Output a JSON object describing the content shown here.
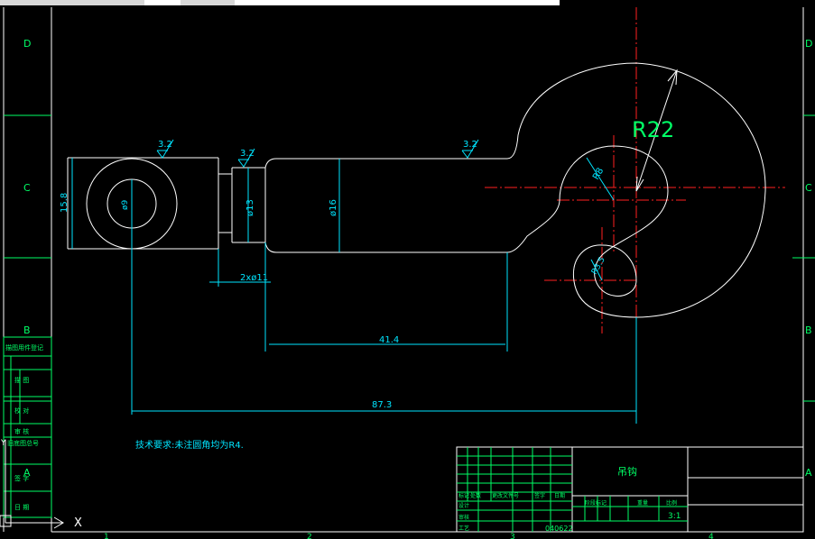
{
  "colors": {
    "background": "#000000",
    "outline": "#ffffff",
    "dimension": "#00e5ff",
    "centerline": "#ff2020",
    "annotation": "#00ff66"
  },
  "frame": {
    "zone_letters_left": [
      "D",
      "C",
      "B",
      "A"
    ],
    "zone_letters_right": [
      "D",
      "C",
      "B",
      "A"
    ],
    "bottom_numbers": [
      "1",
      "2",
      "3",
      "4"
    ]
  },
  "side_stamp": {
    "cells": [
      "描图用件登记",
      "描 图",
      "校 对",
      "审 核",
      "旧底图总号",
      "签 字",
      "日 期"
    ]
  },
  "dimensions": {
    "height_left": "15.8",
    "dia_hole": "ø9",
    "dia_neck": "ø13",
    "dia_shank": "ø16",
    "neck_groove": "2xø11",
    "len_414": "41.4",
    "len_873": "87.3",
    "r22": "R22",
    "r8": "R8",
    "r35": "R3.5",
    "roughness": [
      "3.2",
      "3.2",
      "3.2"
    ]
  },
  "note": "技术要求:未注圆角均为R4.",
  "title_block": {
    "part_name": "吊钩",
    "scale": "3:1",
    "drawing_no": "040622",
    "row_labels": [
      "标记",
      "处数",
      "更改文件号",
      "签字",
      "日期"
    ],
    "people": [
      "设计",
      "审核",
      "工艺"
    ],
    "right_labels": [
      "阶段标记",
      "重量",
      "比例"
    ]
  },
  "ucs": {
    "x_label": "X",
    "y_label": "Y"
  }
}
